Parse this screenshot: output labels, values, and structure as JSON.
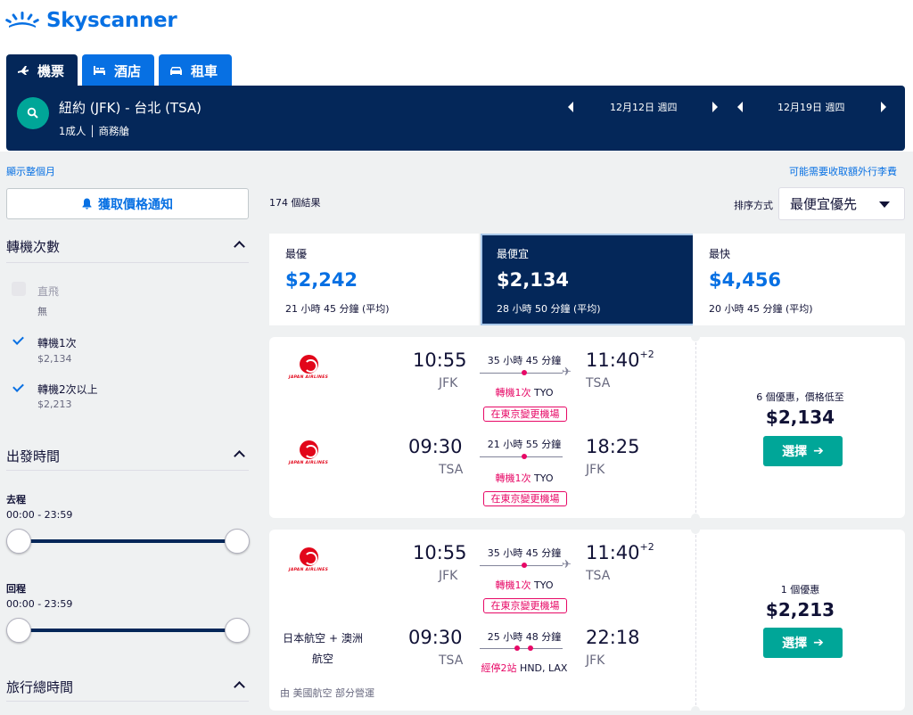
{
  "brand": {
    "name": "Skyscanner",
    "color": "#0770e3"
  },
  "tabs": [
    {
      "label": "機票",
      "icon": "plane-icon",
      "active": true
    },
    {
      "label": "酒店",
      "icon": "bed-icon",
      "active": false
    },
    {
      "label": "租車",
      "icon": "car-icon",
      "active": false
    }
  ],
  "search": {
    "route": "紐約 (JFK) - 台北 (TSA)",
    "pax": "1成人 │ 商務艙",
    "depart_date": "12月12日 週四",
    "return_date": "12月19日 週四"
  },
  "links": {
    "whole_month": "顯示整個月",
    "baggage": "可能需要收取額外行李費"
  },
  "price_alert": "獲取價格通知",
  "filters": {
    "stops": {
      "title": "轉機次數",
      "options": [
        {
          "label": "直飛",
          "price": "無",
          "checked": false,
          "disabled": true
        },
        {
          "label": "轉機1次",
          "price": "$2,134",
          "checked": true,
          "disabled": false
        },
        {
          "label": "轉機2次以上",
          "price": "$2,213",
          "checked": true,
          "disabled": false
        }
      ]
    },
    "departure": {
      "title": "出發時間",
      "outbound_label": "去程",
      "outbound_range": "00:00 - 23:59",
      "return_label": "回程",
      "return_range": "00:00 - 23:59"
    },
    "duration": {
      "title": "旅行總時間"
    }
  },
  "results": {
    "count": "174 個結果",
    "sort_label": "排序方式",
    "sort_value": "最便宜優先"
  },
  "summary": [
    {
      "label": "最優",
      "price": "$2,242",
      "duration": "21 小時 45 分鐘 (平均)",
      "selected": false
    },
    {
      "label": "最便宜",
      "price": "$2,134",
      "duration": "28 小時 50 分鐘 (平均)",
      "selected": true
    },
    {
      "label": "最快",
      "price": "$4,456",
      "duration": "20 小時 45 分鐘 (平均)",
      "selected": false
    }
  ],
  "cards": [
    {
      "legs": [
        {
          "carrier": "JAPAN AIRLINES",
          "depart_time": "10:55",
          "depart_code": "JFK",
          "duration": "35 小時 45 分鐘",
          "arrive_time": "11:40",
          "day_offset": "+2",
          "arrive_code": "TSA",
          "stops_red": "轉機1次",
          "stops_via": " TYO",
          "warning": "在東京變更機場"
        },
        {
          "carrier": "JAPAN AIRLINES",
          "depart_time": "09:30",
          "depart_code": "TSA",
          "duration": "21 小時 55 分鐘",
          "arrive_time": "18:25",
          "day_offset": "",
          "arrive_code": "JFK",
          "stops_red": "轉機1次",
          "stops_via": " TYO",
          "warning": "在東京變更機場"
        }
      ],
      "deals": "6 個優惠，價格低至",
      "price": "$2,134",
      "select_label": "選擇"
    },
    {
      "legs": [
        {
          "carrier": "JAPAN AIRLINES",
          "depart_time": "10:55",
          "depart_code": "JFK",
          "duration": "35 小時 45 分鐘",
          "arrive_time": "11:40",
          "day_offset": "+2",
          "arrive_code": "TSA",
          "stops_red": "轉機1次",
          "stops_via": " TYO",
          "warning": "在東京變更機場"
        },
        {
          "carrier": "日本航空 + 澳洲航空",
          "depart_time": "09:30",
          "depart_code": "TSA",
          "duration": "25 小時 48 分鐘",
          "arrive_time": "22:18",
          "day_offset": "",
          "arrive_code": "JFK",
          "stops_red": "經停2站",
          "stops_via": " HND, LAX",
          "warning": ""
        }
      ],
      "operated": "由 美國航空 部分營運",
      "deals": "1 個優惠",
      "price": "$2,213",
      "select_label": "選擇"
    }
  ]
}
